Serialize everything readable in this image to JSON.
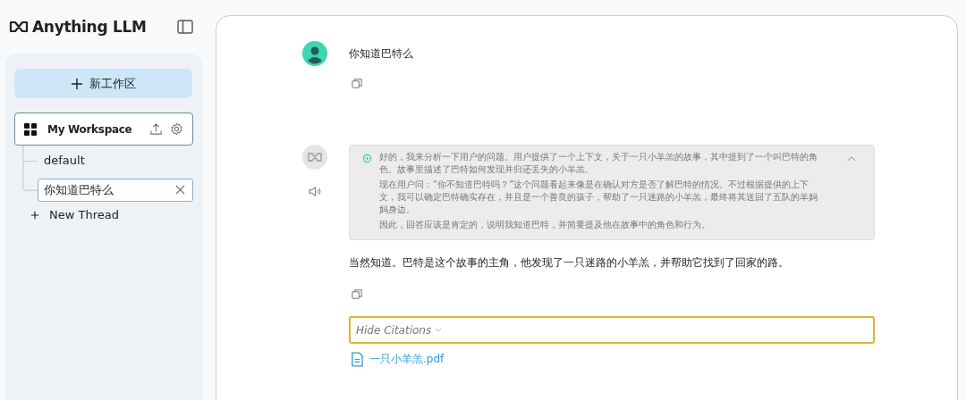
{
  "app": {
    "logo": "Anything LLM"
  },
  "sidebar": {
    "new_workspace_button": "新工作区",
    "workspaces": [
      {
        "name": "My Workspace",
        "selected": true,
        "threads": [
          {
            "title": "default",
            "selected": false
          },
          {
            "title": "你知道巴特么",
            "selected": true
          }
        ]
      }
    ],
    "new_thread": "New Thread"
  },
  "chat": {
    "messages": [
      {
        "kind": "user",
        "text": "你知道巴特么"
      },
      {
        "kind": "assistant",
        "thinking": {
          "expanded": true,
          "paragraphs": [
            "好的，我来分析一下用户的问题。用户提供了一个上下文，关于一只小羊羔的故事，其中提到了一个叫巴特的角色。故事里描述了巴特如何发现并归还丢失的小羊羔。",
            "现在用户问：“你不知道巴特吗？”这个问题看起来像是在确认对方是否了解巴特的情况。不过根据提供的上下文，我可以确定巴特确实存在，并且是一个善良的孩子，帮助了一只迷路的小羊羔，最终将其送回了五队的羊妈妈身边。",
            "因此，回答应该是肯定的，说明我知道巴特，并简要提及他在故事中的角色和行为。"
          ]
        },
        "text": "当然知道。巴特是这个故事的主角，他发现了一只迷路的小羊羔，并帮助它找到了回家的路。",
        "citations": {
          "toggle": "Hide Citations",
          "files": [
            "一只小羊羔.pdf"
          ]
        }
      }
    ]
  }
}
